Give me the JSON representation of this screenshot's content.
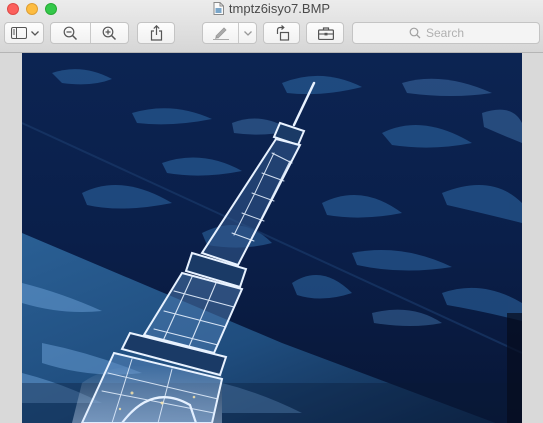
{
  "window": {
    "title": "tmptz6isyo7.BMP"
  },
  "toolbar": {
    "sidebar_icon": "sidebar-icon",
    "zoom_out_icon": "zoom-out-icon",
    "zoom_in_icon": "zoom-in-icon",
    "share_icon": "share-icon",
    "markup_icon": "pen-icon",
    "rotate_icon": "rotate-left-icon",
    "toolbox_icon": "toolbox-icon"
  },
  "search": {
    "placeholder": "Search"
  },
  "colors": {
    "close": "#fc605c",
    "minimize": "#fdbc40",
    "maximize": "#34c84a"
  }
}
